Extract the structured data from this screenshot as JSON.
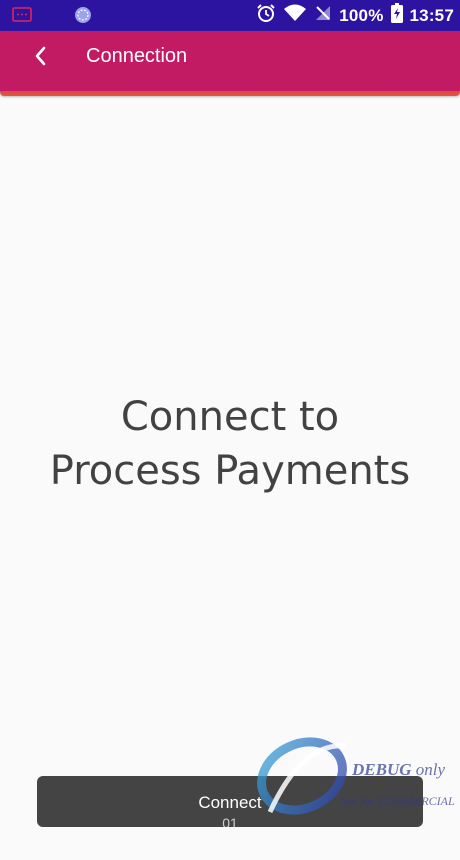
{
  "status_bar": {
    "battery_text": "100%",
    "clock": "13:57",
    "icons": [
      "message-icon",
      "sync-icon",
      "alarm-icon",
      "wifi-icon",
      "no-signal-icon",
      "battery-charging-icon"
    ],
    "background_color": "#2c14a0"
  },
  "app_bar": {
    "title": "Connection",
    "back_icon": "back-arrow-icon",
    "background_color": "#c21b64",
    "accent_color": "#e4553c"
  },
  "main": {
    "headline_line1": "Connect to",
    "headline_line2": "Process Payments"
  },
  "connect_button": {
    "label": "Connect",
    "sub_label": "01",
    "background_color": "#444444"
  },
  "watermark": {
    "title": "DEBUG",
    "title_suffix": "only",
    "subtitle": "Not for COMMERCIAL"
  }
}
